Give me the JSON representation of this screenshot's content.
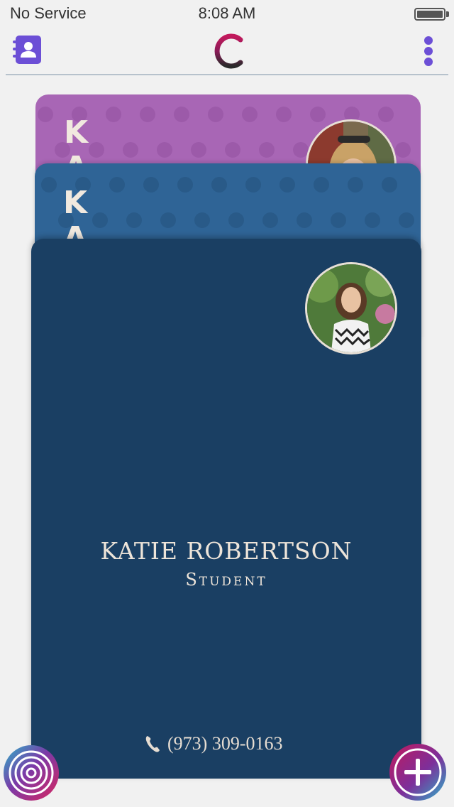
{
  "status_bar": {
    "carrier": "No Service",
    "time": "8:08 AM",
    "battery_level": 1.0
  },
  "nav": {
    "left_icon": "contacts-book-icon",
    "logo_icon": "app-logo-c-icon",
    "right_icon": "more-vertical-icon"
  },
  "cards": [
    {
      "color": "#a866b5",
      "initials": [
        "K",
        "A"
      ]
    },
    {
      "color": "#2f6496",
      "initials": [
        "K",
        "A"
      ]
    },
    {
      "color": "#1a3f63",
      "name": "KATIE ROBERTSON",
      "title": "Student",
      "phone": "(973) 309-0163"
    }
  ],
  "fabs": {
    "left_icon": "concentric-circles-icon",
    "right_icon": "plus-icon"
  },
  "colors": {
    "accent": "#6c4fd6",
    "card_text": "#ede4d9"
  }
}
